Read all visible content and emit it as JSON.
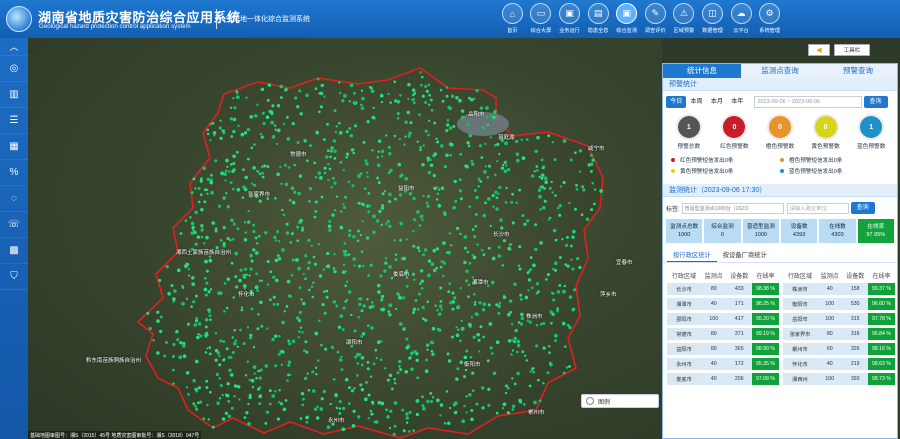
{
  "header": {
    "title_zh": "湖南省地质灾害防治综合应用系统",
    "title_en": "Geological hazard protection control application system",
    "subtitle": "空天地一体化综合监测系统",
    "nav": [
      {
        "label": "首页",
        "icon": "home-icon"
      },
      {
        "label": "综合大屏",
        "icon": "screen-icon"
      },
      {
        "label": "业务运行",
        "icon": "monitor-icon"
      },
      {
        "label": "隐患全息",
        "icon": "document-icon"
      },
      {
        "label": "综合监测",
        "icon": "monitor-icon"
      },
      {
        "label": "调查评价",
        "icon": "survey-icon"
      },
      {
        "label": "区域预警",
        "icon": "warning-icon"
      },
      {
        "label": "数据管理",
        "icon": "database-icon"
      },
      {
        "label": "云平台",
        "icon": "cloud-icon"
      },
      {
        "label": "系统管理",
        "icon": "settings-icon"
      }
    ],
    "active_nav": "综合监测"
  },
  "sidebar": {
    "items": [
      "collapse-icon",
      "layer-icon",
      "book-icon",
      "tag-icon",
      "chart-icon",
      "percent-icon",
      "chat-icon",
      "phone-icon",
      "grid-icon",
      "shield-icon"
    ]
  },
  "map": {
    "labels": [
      {
        "text": "岳阳市"
      },
      {
        "text": "常德市"
      },
      {
        "text": "益阳市"
      },
      {
        "text": "长沙市"
      },
      {
        "text": "湘西土家族苗族自治州"
      },
      {
        "text": "娄底市"
      },
      {
        "text": "湘潭市"
      },
      {
        "text": "株洲市"
      },
      {
        "text": "邵阳市"
      },
      {
        "text": "衡阳市"
      },
      {
        "text": "怀化市"
      },
      {
        "text": "永州市"
      },
      {
        "text": "郴州市"
      },
      {
        "text": "张家界市"
      },
      {
        "text": "洞庭湖"
      },
      {
        "text": "黔东南苗族侗族自治州"
      },
      {
        "text": "桂林市"
      },
      {
        "text": "赣州市"
      },
      {
        "text": "萍乡市"
      },
      {
        "text": "咸宁市"
      },
      {
        "text": "宜春市"
      }
    ],
    "legend_label": "图例",
    "footnote": "基础地图审图号：湘S（2015）45号 地质灾害图审批号：湘S（2018）047号",
    "tool_label": "工具栏"
  },
  "panel": {
    "tabs": [
      "统计信息",
      "监测点查询",
      "预警查询"
    ],
    "active_tab": "统计信息",
    "warning": {
      "title": "预警统计",
      "ranges": [
        "今日",
        "本周",
        "本月",
        "本年"
      ],
      "active_range": "今日",
      "date_placeholder": "2023-09-06  ~  2023-09-06",
      "query_label": "查询",
      "circles": [
        {
          "label": "预警总数",
          "value": "1",
          "color": "#555555"
        },
        {
          "label": "红色预警数",
          "value": "0",
          "color": "#c81e2a"
        },
        {
          "label": "橙色预警数",
          "value": "0",
          "color": "#e8932b"
        },
        {
          "label": "黄色预警数",
          "value": "0",
          "color": "#d8d41a"
        },
        {
          "label": "蓝色预警数",
          "value": "1",
          "color": "#1f90c8"
        }
      ],
      "alerts": [
        {
          "text": "红色预警短信发出0条",
          "color": "#c81e2a"
        },
        {
          "text": "橙色预警短信发出0条",
          "color": "#e8932b"
        },
        {
          "text": "黄色预警短信发出0条",
          "color": "#d8d41a"
        },
        {
          "text": "蓝色预警短信发出0条",
          "color": "#1f90c8"
        }
      ]
    },
    "monitor": {
      "title": "监测统计（2023-09-06 17:30）",
      "label": "标签:",
      "select_value": "普适型监测点1000台（2023）",
      "unit_placeholder": "请输入政企单位",
      "query_label": "查询",
      "boxes": [
        {
          "title": "监测点总数",
          "value": "1000"
        },
        {
          "title": "综合监测",
          "value": "0"
        },
        {
          "title": "普适型监测",
          "value": "1000"
        },
        {
          "title": "设备数",
          "value": "4393"
        },
        {
          "title": "在线数",
          "value": "4303"
        },
        {
          "title": "在线率",
          "value": "97.95%"
        }
      ],
      "subtabs": [
        "按行政区统计",
        "按设备厂商统计"
      ],
      "active_subtab": "按行政区统计",
      "headers": [
        "行政区域",
        "监测点",
        "设备数",
        "在线率",
        "行政区域",
        "监测点",
        "设备数",
        "在线率"
      ],
      "rows": [
        [
          "长沙市",
          "80",
          "433",
          "98.38 %",
          "株洲市",
          "40",
          "158",
          "99.37 %"
        ],
        [
          "湘潭市",
          "40",
          "171",
          "98.25 %",
          "衡阳市",
          "100",
          "530",
          "96.60 %"
        ],
        [
          "邵阳市",
          "100",
          "417",
          "95.20 %",
          "岳阳市",
          "100",
          "315",
          "97.78 %"
        ],
        [
          "常德市",
          "80",
          "371",
          "99.19 %",
          "张家界市",
          "80",
          "316",
          "96.84 %"
        ],
        [
          "益阳市",
          "80",
          "365",
          "98.90 %",
          "郴州市",
          "60",
          "326",
          "98.16 %"
        ],
        [
          "永州市",
          "40",
          "172",
          "95.35 %",
          "怀化市",
          "40",
          "219",
          "98.63 %"
        ],
        [
          "娄底市",
          "40",
          "206",
          "97.09 %",
          "湘西州",
          "100",
          "393",
          "98.73 %"
        ]
      ]
    }
  }
}
